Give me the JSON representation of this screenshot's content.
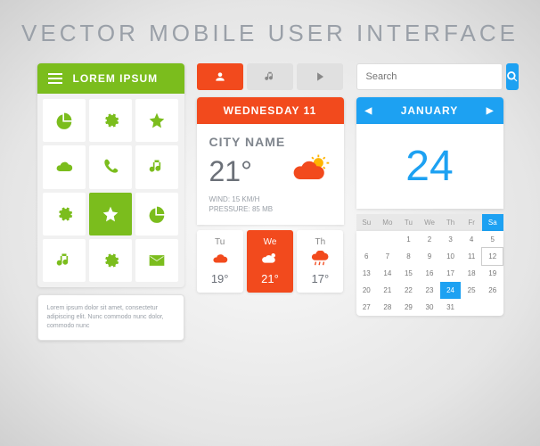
{
  "title": "VECTOR MOBILE USER INTERFACE",
  "colors": {
    "green": "#7bbd1d",
    "orange": "#f24a1d",
    "blue": "#1da1f2"
  },
  "menu": {
    "header": "LOREM IPSUM",
    "icons": [
      "pie-chart",
      "gear",
      "star",
      "cloud",
      "phone",
      "music",
      "gear",
      "star",
      "pie-chart",
      "music",
      "gear",
      "mail"
    ],
    "active_index": 7
  },
  "lorem": "Lorem ipsum dolor sit amet, consectetur adipiscing elit. Nunc commodo nunc dolor, commodo nunc",
  "toolbar": {
    "buttons": [
      "user",
      "music",
      "play"
    ],
    "active_index": 0
  },
  "weather": {
    "date_bar": "WEDNESDAY 11",
    "city": "CITY NAME",
    "temp": "21°",
    "wind_label": "WIND:",
    "wind_val": "15 KM/H",
    "pressure_label": "PRESSURE:",
    "pressure_val": "85 MB",
    "forecast": [
      {
        "day": "Tu",
        "icon": "cloud",
        "temp": "19°"
      },
      {
        "day": "We",
        "icon": "sun-cloud",
        "temp": "21°",
        "active": true
      },
      {
        "day": "Th",
        "icon": "rain",
        "temp": "17°"
      }
    ]
  },
  "search": {
    "placeholder": "Search"
  },
  "calendar": {
    "month": "JANUARY",
    "big_day": "24",
    "dow": [
      "Su",
      "Mo",
      "Tu",
      "We",
      "Th",
      "Fr",
      "Sa"
    ],
    "days": [
      "",
      "",
      "1",
      "2",
      "3",
      "4",
      "5",
      "6",
      "7",
      "8",
      "9",
      "10",
      "11",
      "12",
      "13",
      "14",
      "15",
      "16",
      "17",
      "18",
      "19",
      "20",
      "21",
      "22",
      "23",
      "24",
      "25",
      "26",
      "27",
      "28",
      "29",
      "30",
      "31",
      "",
      ""
    ],
    "selected": "24",
    "boxed": "12"
  }
}
